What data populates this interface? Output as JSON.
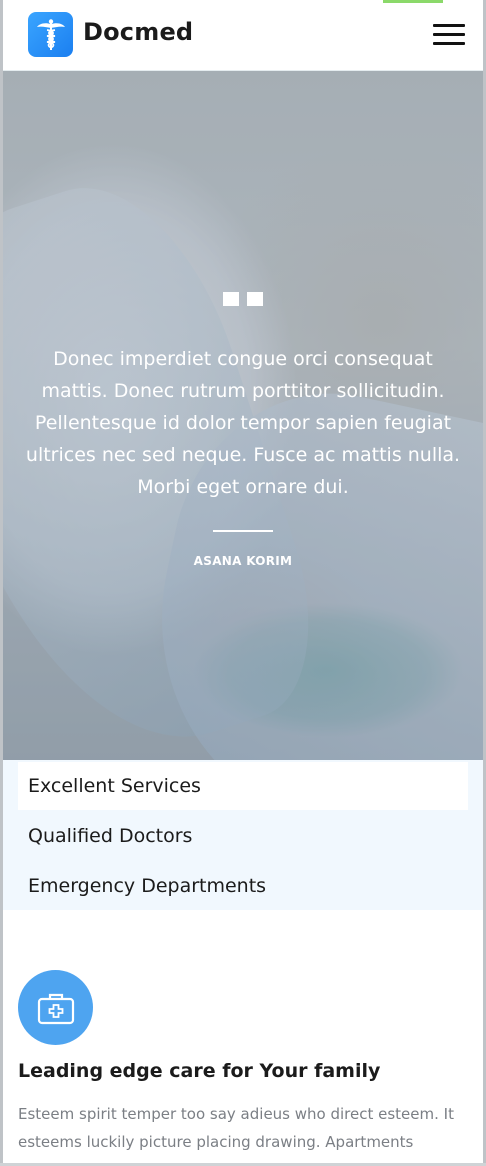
{
  "header": {
    "brand": "Docmed",
    "logo_icon": "caduceus-icon",
    "menu_icon": "hamburger-menu-icon",
    "accent_color": "#8bd96a"
  },
  "hero": {
    "quote_icon": "quote-icon",
    "quote": "Donec imperdiet congue orci consequat mattis. Donec rutrum porttitor sollicitudin. Pellentesque id dolor tempor sapien feugiat ultrices nec sed neque. Fusce ac mattis nulla. Morbi eget ornare dui.",
    "author": "ASANA KORIM"
  },
  "services": {
    "items": [
      {
        "label": "Excellent Services",
        "active": true
      },
      {
        "label": "Qualified Doctors",
        "active": false
      },
      {
        "label": "Emergency Departments",
        "active": false
      }
    ],
    "background": "#f1f8fe"
  },
  "feature": {
    "icon": "medical-kit-icon",
    "icon_color": "#4ea4f0",
    "title": "Leading edge care for Your family",
    "text": "Esteem spirit temper too say adieus who direct esteem. It esteems luckily picture placing drawing. Apartments frequently or motionless on reasonable projecting expression."
  }
}
